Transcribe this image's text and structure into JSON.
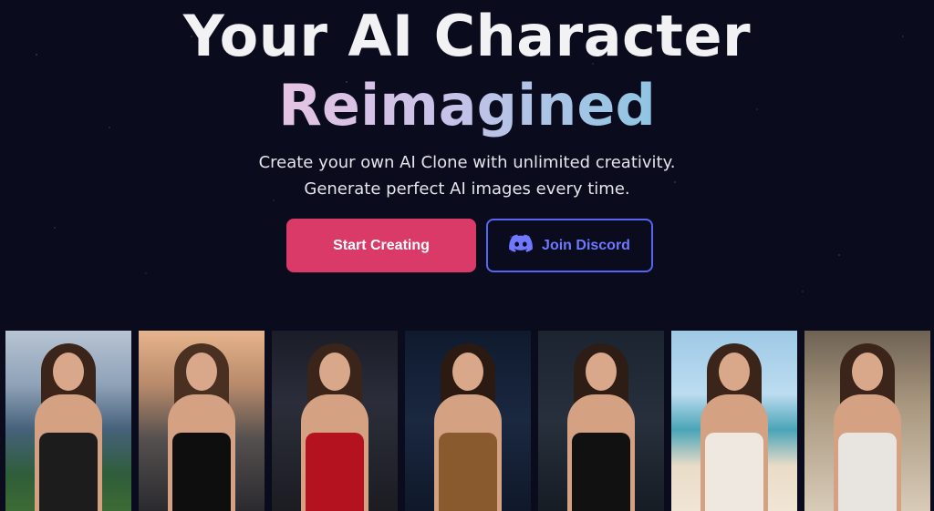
{
  "hero": {
    "title_line1": "Your AI Character",
    "title_line2": "Reimagined",
    "subtitle_line1": "Create your own AI Clone with unlimited creativity.",
    "subtitle_line2": "Generate perfect AI images every time."
  },
  "buttons": {
    "start_label": "Start Creating",
    "discord_label": "Join Discord"
  },
  "colors": {
    "background": "#0a0c1e",
    "primary": "#d93a68",
    "discord": "#5865f2"
  },
  "gallery": [
    {
      "scene": "mountain-lake",
      "outfit": "#1c1c1c"
    },
    {
      "scene": "city-skyline",
      "outfit": "#0e0e0e"
    },
    {
      "scene": "red-carpet",
      "outfit": "#b3121e"
    },
    {
      "scene": "dark-studio",
      "outfit": "#8a5a2f"
    },
    {
      "scene": "dark-room",
      "outfit": "#111111"
    },
    {
      "scene": "beach",
      "outfit": "#efe8e0"
    },
    {
      "scene": "bedroom",
      "outfit": "#e8e4e0"
    }
  ]
}
